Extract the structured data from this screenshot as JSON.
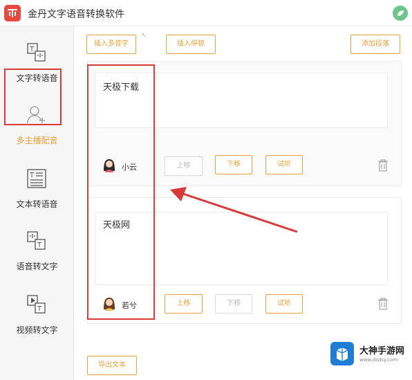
{
  "app": {
    "title": "金丹文字语音转换软件"
  },
  "sidebar": {
    "items": [
      {
        "label": "文字转语音",
        "icon": "text-to-speech-icon"
      },
      {
        "label": "多主播配音",
        "icon": "multi-anchor-icon",
        "active": true
      },
      {
        "label": "文本转语音",
        "icon": "document-text-icon"
      },
      {
        "label": "语音转文字",
        "icon": "speech-to-text-icon"
      },
      {
        "label": "视频转文字",
        "icon": "video-to-text-icon"
      }
    ]
  },
  "toolbar": {
    "insert_polyphone": "插入多音字",
    "insert_pause": "插入停顿",
    "add_segment": "添加段落"
  },
  "segments": [
    {
      "text": "天极下载",
      "voice": "小云",
      "buttons": {
        "up": "上移",
        "down": "下移",
        "listen": "试听"
      },
      "up_enabled": false,
      "down_enabled": true
    },
    {
      "text": "天极网",
      "voice": "若兮",
      "buttons": {
        "up": "上移",
        "down": "下移",
        "listen": "试听"
      },
      "up_enabled": true,
      "down_enabled": false
    }
  ],
  "footer": {
    "import_text": "导出文本"
  },
  "watermark": {
    "title": "大神手游网",
    "subtitle": "www.dsdsy.com"
  },
  "colors": {
    "accent": "#e8a33c",
    "highlight": "#d83a3a",
    "logo": "#e8493f"
  }
}
